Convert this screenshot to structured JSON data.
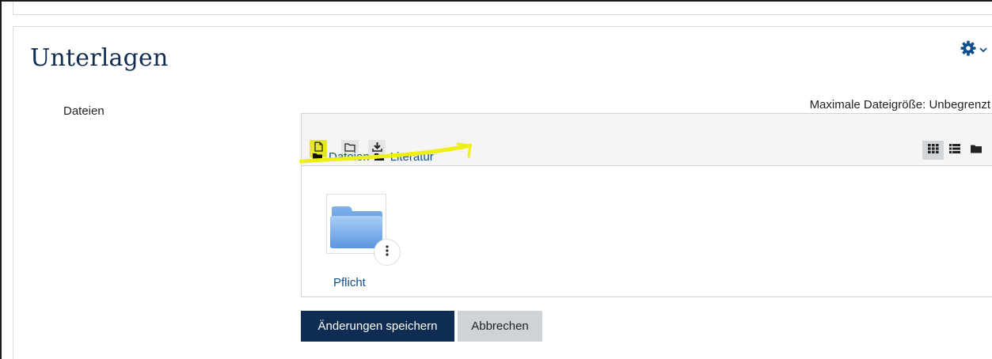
{
  "page": {
    "title": "Unterlagen",
    "settings_icon": "gear-icon",
    "settings_menu_icon": "chevron-down-icon"
  },
  "form": {
    "field_label": "Dateien",
    "max_size_text": "Maximale Dateigröße: Unbegrenzt"
  },
  "filemanager": {
    "toolbar": [
      {
        "name": "add-file-button",
        "icon": "file-icon",
        "highlighted": true
      },
      {
        "name": "create-folder-button",
        "icon": "folder-outline-icon",
        "highlighted": false
      },
      {
        "name": "download-button",
        "icon": "download-icon",
        "highlighted": false
      }
    ],
    "views": [
      {
        "name": "icons-view-button",
        "icon": "grid-icon",
        "active": true
      },
      {
        "name": "details-view-button",
        "icon": "list-icon",
        "active": false
      },
      {
        "name": "tree-view-button",
        "icon": "folder-icon",
        "active": false
      }
    ],
    "breadcrumb": [
      "Dateien",
      "Literatur"
    ],
    "items": [
      {
        "name": "Pflicht",
        "type": "folder"
      }
    ]
  },
  "buttons": {
    "save_label": "Änderungen speichern",
    "cancel_label": "Abbrechen"
  },
  "colors": {
    "title": "#0f2d52",
    "link": "#0f4f8c",
    "primary_button": "#0f2d52",
    "secondary_button": "#cfd3d6",
    "highlight": "#e8ea2c"
  }
}
